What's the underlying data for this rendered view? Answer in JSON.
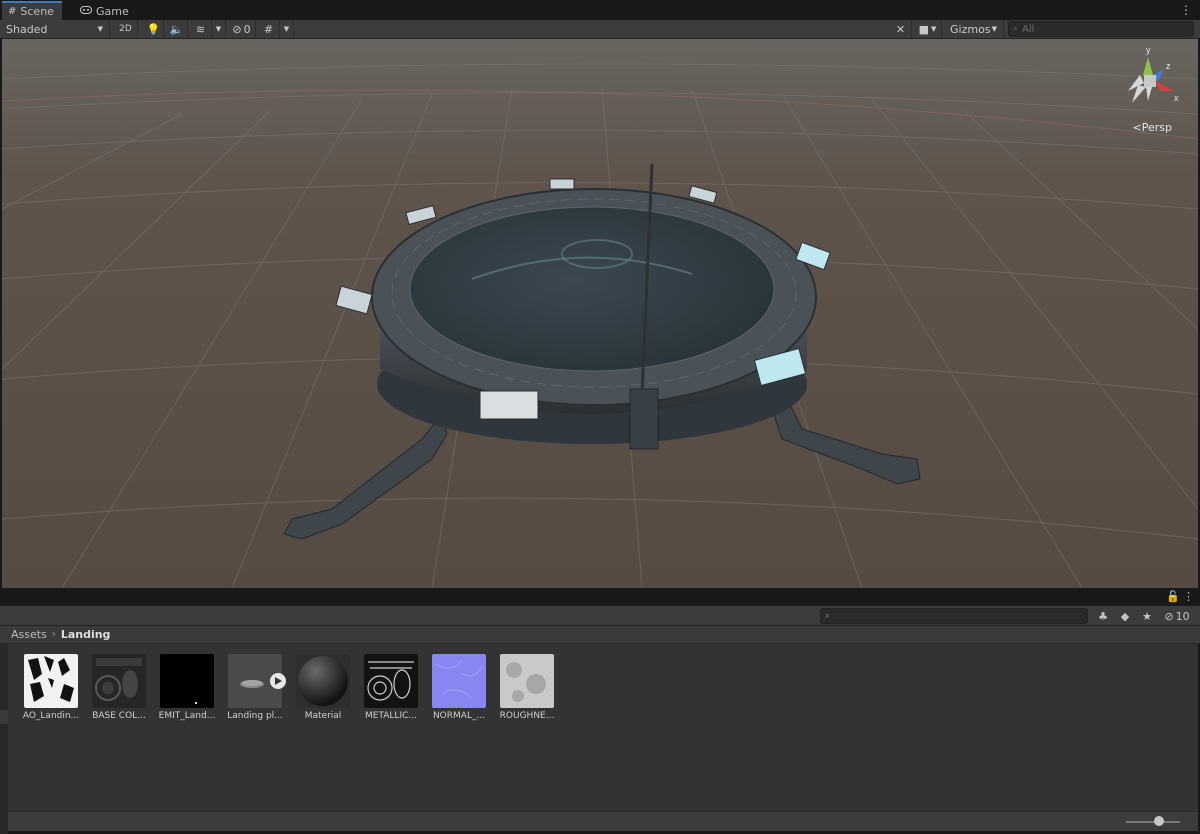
{
  "tabs": [
    {
      "label": "Scene",
      "icon": "grid-icon",
      "active": true
    },
    {
      "label": "Game",
      "icon": "gamepad-icon",
      "active": false
    }
  ],
  "toolbar": {
    "shading_mode": "Shaded",
    "mode_2d": "2D",
    "hidden_count": "0",
    "gizmos_label": "Gizmos",
    "search_placeholder": "All"
  },
  "viewport": {
    "projection_label": "Persp",
    "gizmo_axes": {
      "y": "y",
      "z": "z",
      "x": "x"
    }
  },
  "project": {
    "breadcrumb": [
      "Assets",
      "Landing"
    ],
    "hidden_count": "10",
    "assets": [
      {
        "label": "AO_Landin...",
        "kind": "texture-ao"
      },
      {
        "label": "BASE COL...",
        "kind": "texture-base"
      },
      {
        "label": "EMIT_Land...",
        "kind": "texture-emit"
      },
      {
        "label": "Landing pl...",
        "kind": "model"
      },
      {
        "label": "Material",
        "kind": "material"
      },
      {
        "label": "METALLIC...",
        "kind": "texture-metallic"
      },
      {
        "label": "NORMAL_...",
        "kind": "texture-normal"
      },
      {
        "label": "ROUGHNE...",
        "kind": "texture-roughness"
      }
    ]
  },
  "colors": {
    "accent": "#3a79bb",
    "viewport_bg": "#5a4f47",
    "panel_bg": "#3c3c3c"
  }
}
